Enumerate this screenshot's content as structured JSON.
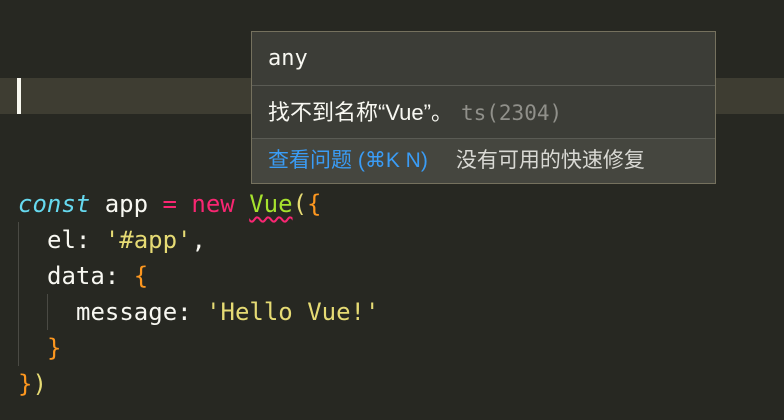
{
  "editor": {
    "lines": {
      "decl": {
        "const": "const",
        "name": " app ",
        "eq": "=",
        "new": " new ",
        "cls": "Vue",
        "open_paren": "(",
        "open_brace": "{"
      },
      "el": {
        "key": "el",
        "colon": ": ",
        "value": "'#app'",
        "comma": ","
      },
      "data": {
        "key": "data",
        "colon": ": ",
        "open_brace": "{"
      },
      "message": {
        "key": "message",
        "colon": ": ",
        "value": "'Hello Vue!'"
      },
      "close_inner": "}",
      "close_outer_brace": "}",
      "close_outer_paren": ")"
    }
  },
  "hover": {
    "type": "any",
    "message": "找不到名称“Vue”。",
    "code": "ts(2304)",
    "view_problem": "查看问题 (⌘K N)",
    "no_quick_fix": "没有可用的快速修复"
  },
  "colors": {
    "background": "#272822",
    "keyword": "#f92672",
    "storage": "#66d9ef",
    "class": "#a6e22e",
    "string": "#e6db74",
    "link": "#3a9cf5"
  }
}
